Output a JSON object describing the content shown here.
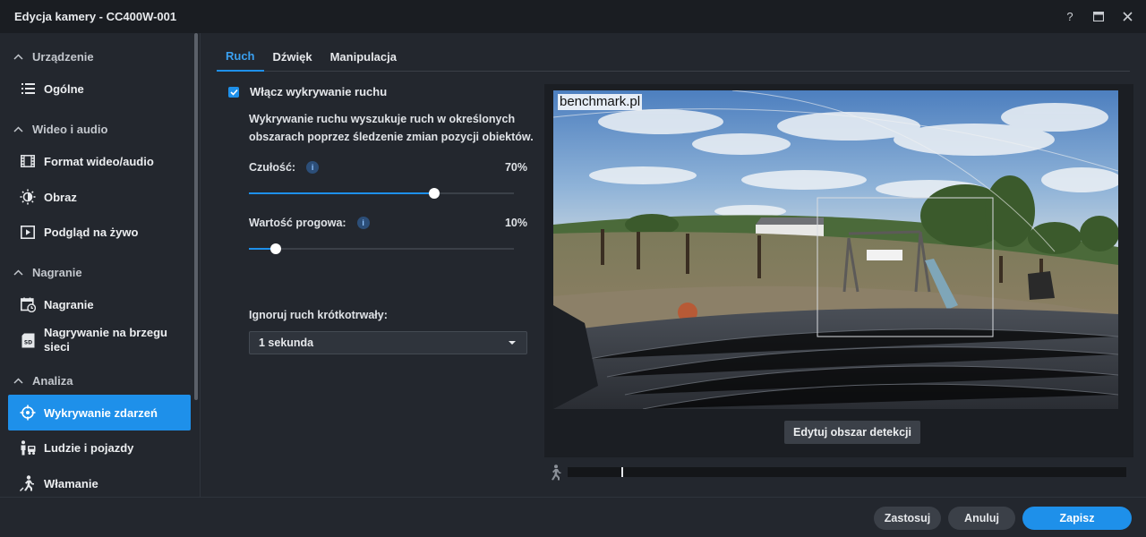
{
  "window": {
    "title": "Edycja kamery - CC400W-001",
    "controls": [
      "help-icon",
      "maximize-icon",
      "close-icon"
    ]
  },
  "sidebar": {
    "sections": [
      {
        "title": "Urządzenie",
        "items": [
          {
            "label": "Ogólne",
            "icon": "list-icon"
          }
        ]
      },
      {
        "title": "Wideo i audio",
        "items": [
          {
            "label": "Format wideo/audio",
            "icon": "film-icon"
          },
          {
            "label": "Obraz",
            "icon": "brightness-icon"
          },
          {
            "label": "Podgląd na żywo",
            "icon": "play-icon"
          }
        ]
      },
      {
        "title": "Nagranie",
        "items": [
          {
            "label": "Nagranie",
            "icon": "calendar-clock-icon"
          },
          {
            "label": "Nagrywanie na brzegu sieci",
            "icon": "sd-card-icon"
          }
        ]
      },
      {
        "title": "Analiza",
        "items": [
          {
            "label": "Wykrywanie zdarzeń",
            "icon": "crosshair-icon",
            "active": true
          },
          {
            "label": "Ludzie i pojazdy",
            "icon": "people-vehicle-icon"
          },
          {
            "label": "Włamanie",
            "icon": "intruder-icon"
          }
        ]
      }
    ]
  },
  "tabs": [
    {
      "label": "Ruch",
      "active": true
    },
    {
      "label": "Dźwięk"
    },
    {
      "label": "Manipulacja"
    }
  ],
  "motion": {
    "enable_label": "Włącz wykrywanie ruchu",
    "enabled": true,
    "description": "Wykrywanie ruchu wyszukuje ruch w określonych obszarach poprzez śledzenie zmian pozycji obiektów.",
    "sensitivity_label": "Czułość:",
    "sensitivity_value": "70%",
    "sensitivity": 70,
    "threshold_label": "Wartość progowa:",
    "threshold_value": "10%",
    "threshold": 10,
    "ignore_label": "Ignoruj ruch krótkotrwały:",
    "ignore_selected": "1 sekunda",
    "info_glyph": "i"
  },
  "preview": {
    "watermark": "benchmark.pl",
    "edit_button": "Edytuj obszar detekcji"
  },
  "footer": {
    "apply": "Zastosuj",
    "cancel": "Anuluj",
    "save": "Zapisz"
  },
  "colors": {
    "accent": "#1e90ea",
    "background": "#23272e",
    "titlebar": "#1a1d22"
  }
}
